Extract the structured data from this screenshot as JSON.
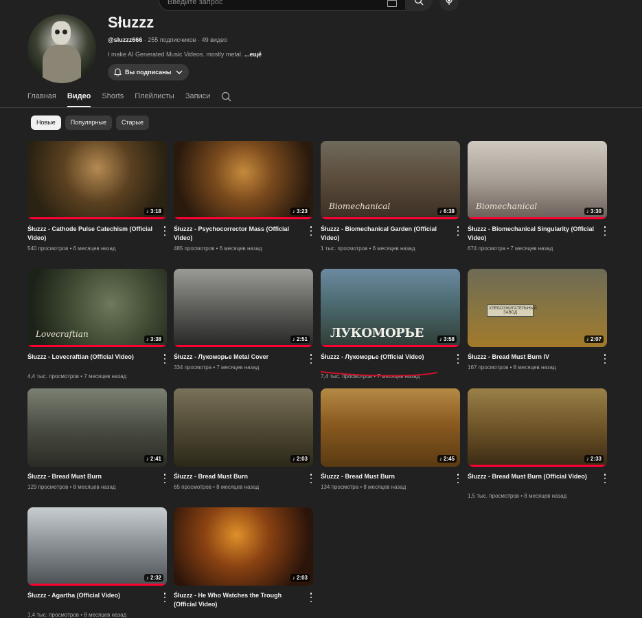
{
  "search": {
    "placeholder": "Введите запрос"
  },
  "channel": {
    "name": "Słuzzz",
    "handle": "@sluzzz666",
    "stats": " · 255 подписчиков · 49 видео",
    "description": "I make AI Generated Music Videos. mostly metal.",
    "more": "...ещё",
    "subscribe_label": "Вы подписаны"
  },
  "tabs": [
    "Главная",
    "Видео",
    "Shorts",
    "Плейлисты",
    "Записи"
  ],
  "chips": [
    "Новые",
    "Популярные",
    "Старые"
  ],
  "videos": [
    {
      "title": "Śłuzzz - Cathode Pulse Catechism (Official Video)",
      "views": "540 просмотров",
      "age": "6 месяцев назад",
      "duration": "3:18",
      "watched": 1.0
    },
    {
      "title": "Śłuzzz - Psychocorrector Mass (Official Video)",
      "views": "485 просмотров",
      "age": "6 месяцев назад",
      "duration": "3:23",
      "watched": 1.0
    },
    {
      "title": "Śłuzzz - Biomechanical Garden (Official Video)",
      "views": "1 тыс. просмотров",
      "age": "6 месяцев назад",
      "duration": "6:38",
      "watched": 1.0,
      "overlay": "Biomechanical"
    },
    {
      "title": "Śłuzzz - Biomechanical Singularity (Official Video)",
      "views": "674 просмотра",
      "age": "7 месяцев назад",
      "duration": "3:30",
      "watched": 1.0,
      "overlay": "Biomechanical"
    },
    {
      "title": "Śłuzzz - Lovecraftian (Official Video)",
      "views": "4,4 тыс. просмотров",
      "age": "7 месяцев назад",
      "duration": "3:38",
      "watched": 1.0,
      "overlay": "Lovecraftian"
    },
    {
      "title": "Śłuzzz - Лукоморье Metal Cover",
      "views": "334 просмотра",
      "age": "7 месяцев назад",
      "duration": "2:51",
      "watched": 1.0
    },
    {
      "title": "Śłuzzz - Лукоморье (Official Video)",
      "views": "7,4 тыс. просмотров",
      "age": "7 месяцев назад",
      "duration": "3:58",
      "watched": 1.0,
      "overlay": "ЛУКОМОРЬЕ"
    },
    {
      "title": "Śłuzzz - Bread Must Burn IV",
      "views": "167 просмотров",
      "age": "8 месяцев назад",
      "duration": "2:07",
      "watched": 0,
      "sign": "ХЛЕБОЗЖИГАТЕЛЬНЫЙ ЗАВОД"
    },
    {
      "title": "Śłuzzz - Bread Must Burn",
      "views": "129 просмотров",
      "age": "8 месяцев назад",
      "duration": "2:41",
      "watched": 0
    },
    {
      "title": "Śłuzzz - Bread Must Burn",
      "views": "65 просмотров",
      "age": "8 месяцев назад",
      "duration": "2:03",
      "watched": 0
    },
    {
      "title": "Śłuzzz - Bread Must Burn",
      "views": "134 просмотра",
      "age": "8 месяцев назад",
      "duration": "2:45",
      "watched": 0
    },
    {
      "title": "Śłuzzz - Bread Must Burn (Official Video)",
      "views": "1,5 тыс. просмотров",
      "age": "8 месяцев назад",
      "duration": "2:33",
      "watched": 1.0
    },
    {
      "title": "Śłuzzz - Agartha (Official Video)",
      "views": "1,4 тыс. просмотров",
      "age": "8 месяцев назад",
      "duration": "2:32",
      "watched": 1.0
    },
    {
      "title": "Śłuzzz - He Who Watches the Trough (Official Video)",
      "views": "",
      "age": "",
      "duration": "2:03",
      "watched": 0
    }
  ],
  "colors": {
    "background": "#212121",
    "progress": "#ff0033",
    "annotation": "#d0102a"
  }
}
